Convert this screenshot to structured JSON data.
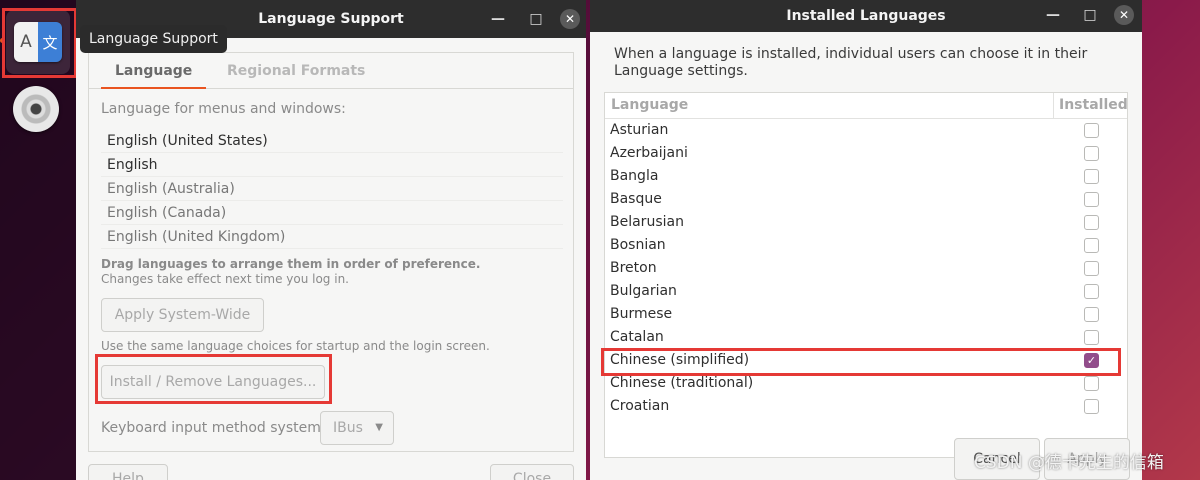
{
  "dock": {
    "tooltip": "Language Support",
    "lang_icon_left": "A",
    "lang_icon_right": "文"
  },
  "language_support": {
    "title": "Language Support",
    "tabs": [
      {
        "label": "Language",
        "active": true
      },
      {
        "label": "Regional Formats",
        "active": false
      }
    ],
    "menus_label": "Language for menus and windows:",
    "languages": [
      {
        "label": "English (United States)",
        "emphasis": true
      },
      {
        "label": "English",
        "emphasis": true
      },
      {
        "label": "English (Australia)",
        "emphasis": false
      },
      {
        "label": "English (Canada)",
        "emphasis": false
      },
      {
        "label": "English (United Kingdom)",
        "emphasis": false
      }
    ],
    "drag_hint": "Drag languages to arrange them in order of preference.",
    "changes_hint": "Changes take effect next time you log in.",
    "apply_button": "Apply System-Wide",
    "same_choices_hint": "Use the same language choices for startup and the login screen.",
    "install_button": "Install / Remove Languages...",
    "keyboard_label": "Keyboard input method system:",
    "keyboard_value": "IBus",
    "help_button": "Help",
    "close_button": "Close"
  },
  "installed_languages": {
    "title": "Installed Languages",
    "intro": "When a language is installed, individual users can choose it in their Language settings.",
    "col_language": "Language",
    "col_installed": "Installed",
    "rows": [
      {
        "name": "Asturian",
        "installed": false
      },
      {
        "name": "Azerbaijani",
        "installed": false
      },
      {
        "name": "Bangla",
        "installed": false
      },
      {
        "name": "Basque",
        "installed": false
      },
      {
        "name": "Belarusian",
        "installed": false
      },
      {
        "name": "Bosnian",
        "installed": false
      },
      {
        "name": "Breton",
        "installed": false
      },
      {
        "name": "Bulgarian",
        "installed": false
      },
      {
        "name": "Burmese",
        "installed": false
      },
      {
        "name": "Catalan",
        "installed": false
      },
      {
        "name": "Chinese (simplified)",
        "installed": true
      },
      {
        "name": "Chinese (traditional)",
        "installed": false
      },
      {
        "name": "Croatian",
        "installed": false
      }
    ],
    "cancel_button": "Cancel",
    "apply_button": "Apply"
  },
  "watermark": "CSDN @德卡先生的信箱",
  "colors": {
    "accent": "#e95420",
    "highlight": "#e53935",
    "checkbox_checked": "#924d8b"
  }
}
